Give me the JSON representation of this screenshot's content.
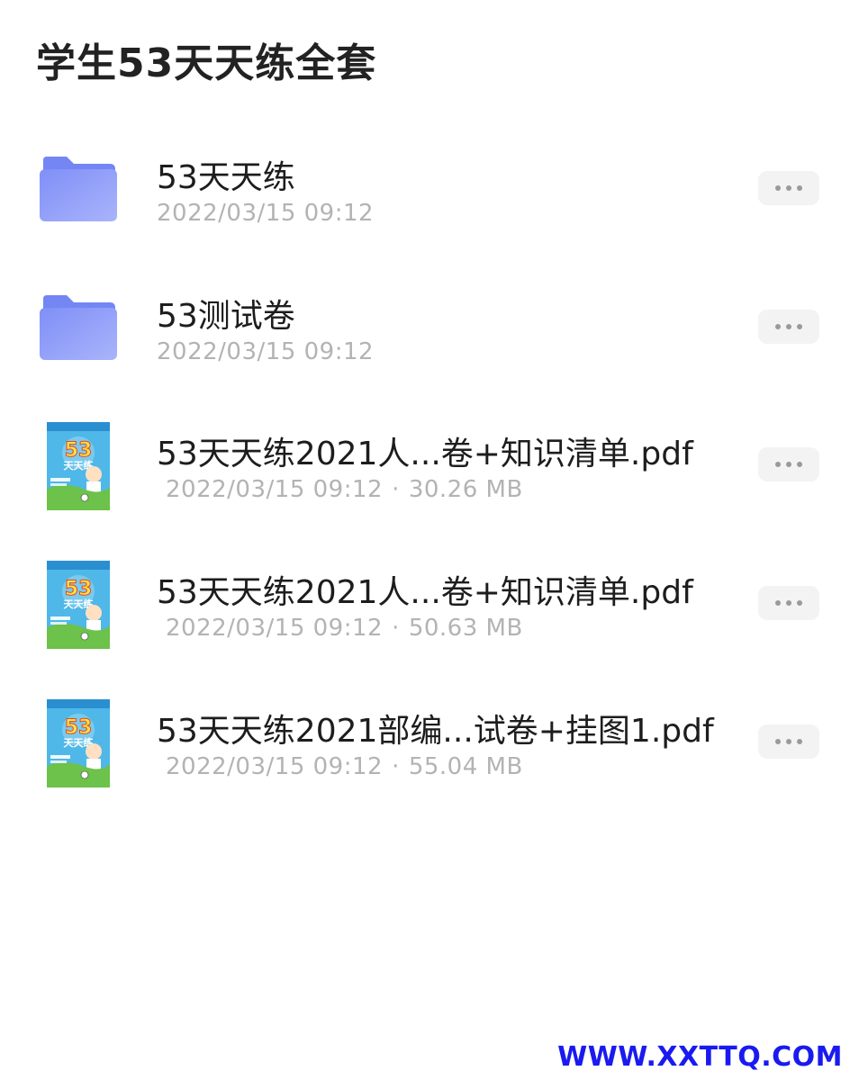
{
  "header": {
    "title": "学生53天天练全套"
  },
  "files": [
    {
      "type": "folder",
      "name": "53天天练",
      "date": "2022/03/15 09:12"
    },
    {
      "type": "folder",
      "name": "53测试卷",
      "date": "2022/03/15 09:12"
    },
    {
      "type": "pdf",
      "name": "53天天练2021人...卷+知识清单.pdf",
      "date": "2022/03/15 09:12",
      "separator": "·",
      "size": "30.26 MB"
    },
    {
      "type": "pdf",
      "name": "53天天练2021人...卷+知识清单.pdf",
      "date": "2022/03/15 09:12",
      "separator": "·",
      "size": "50.63 MB"
    },
    {
      "type": "pdf",
      "name": "53天天练2021部编...试卷+挂图1.pdf",
      "date": "2022/03/15 09:12",
      "separator": "·",
      "size": "55.04 MB"
    }
  ],
  "thumbnail": {
    "cover_text": "53",
    "cover_subtext": "天天练"
  },
  "watermark": {
    "text": "WWW.XXTTQ.COM"
  },
  "colors": {
    "folder_front": "#8a9cf8",
    "folder_back": "#7a8cf2",
    "accent_watermark": "#1a1af0",
    "meta_text": "#b3b3b3"
  },
  "icons": {
    "folder": "folder-icon",
    "pdf": "pdf-thumbnail",
    "more": "more-horizontal-icon"
  }
}
